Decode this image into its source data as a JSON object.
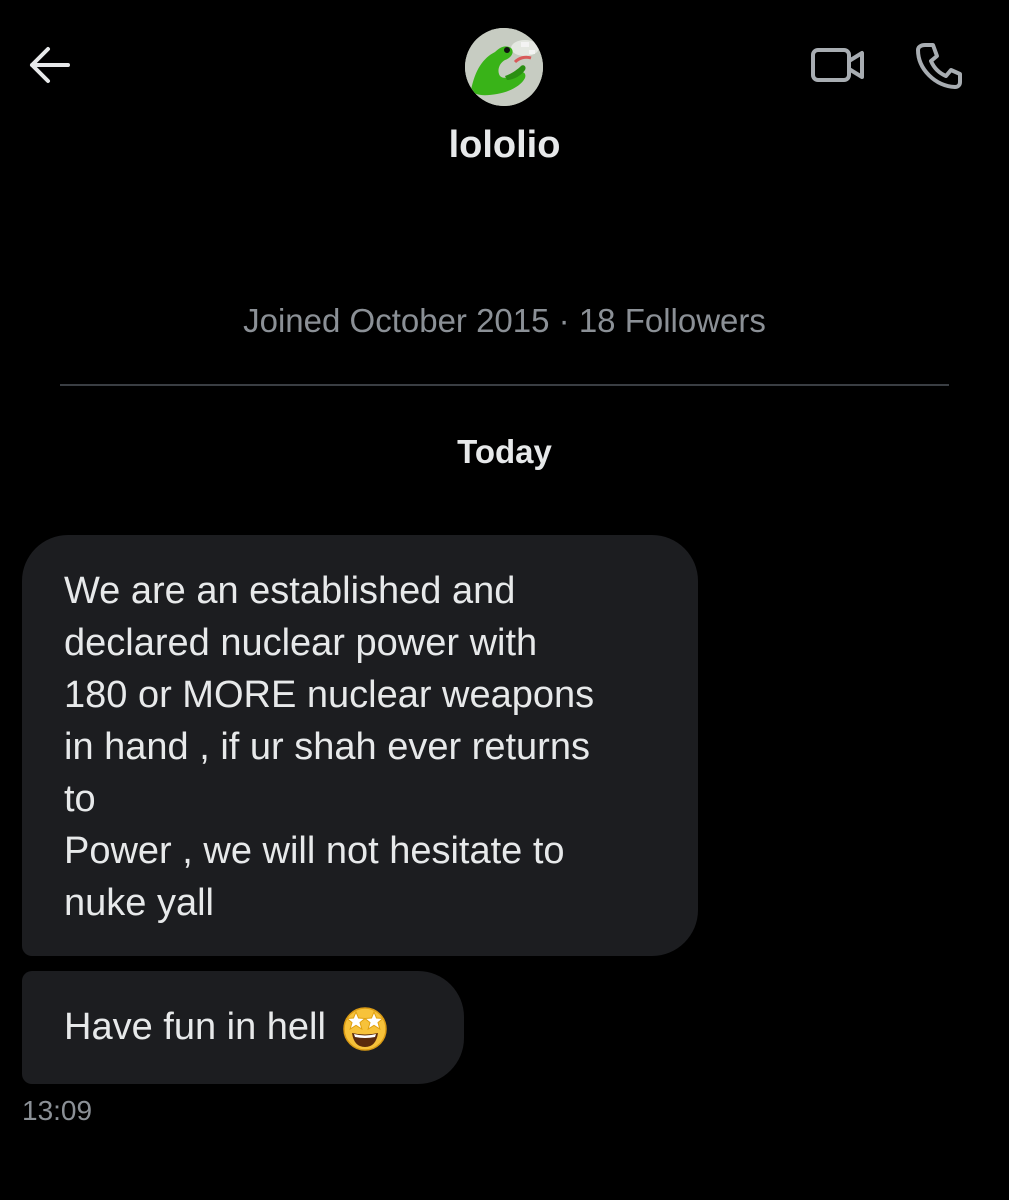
{
  "header": {
    "username": "lololio",
    "back_icon": "arrow-left-icon",
    "video_icon": "video-camera-icon",
    "call_icon": "phone-icon",
    "avatar_icon": "green-frog-avatar"
  },
  "profile": {
    "meta": "Joined October 2015 · 18 Followers"
  },
  "conversation": {
    "date_label": "Today",
    "messages": [
      {
        "lines": [
          "We are an established and",
          "declared nuclear power with",
          "180 or MORE nuclear weapons",
          "in hand , if ur shah ever returns",
          "to",
          "Power , we will not hesitate to",
          "nuke yall"
        ]
      },
      {
        "text": "Have fun in hell",
        "emoji": "star-struck-emoji"
      }
    ],
    "timestamp": "13:09"
  },
  "colors": {
    "background": "#000000",
    "bubble": "#1c1d20",
    "text": "#e7e9ea",
    "muted": "#8b9096",
    "divider": "#3a3e43"
  }
}
